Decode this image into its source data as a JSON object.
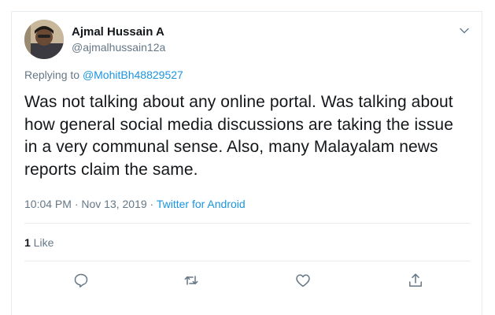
{
  "author": {
    "name": "Ajmal Hussain A",
    "handle": "@ajmalhussain12a"
  },
  "reply": {
    "prefix": "Replying to ",
    "mention": "@MohitBh48829527"
  },
  "tweet": {
    "text": "Was not talking about any online portal. Was talking about how general social media discussions are taking the issue in a very communal sense. Also, many Malayalam news reports claim the same."
  },
  "meta": {
    "timestamp": "10:04 PM · Nov 13, 2019 · ",
    "source": "Twitter for Android"
  },
  "stats": {
    "likes_count": "1",
    "likes_label": " Like"
  },
  "icons": {
    "menu": "chevron-down-icon",
    "reply": "reply-icon",
    "retweet": "retweet-icon",
    "like": "heart-icon",
    "share": "share-icon"
  },
  "colors": {
    "link": "#1b95e0",
    "secondary_text": "#657786",
    "border": "#e6ecf0"
  }
}
